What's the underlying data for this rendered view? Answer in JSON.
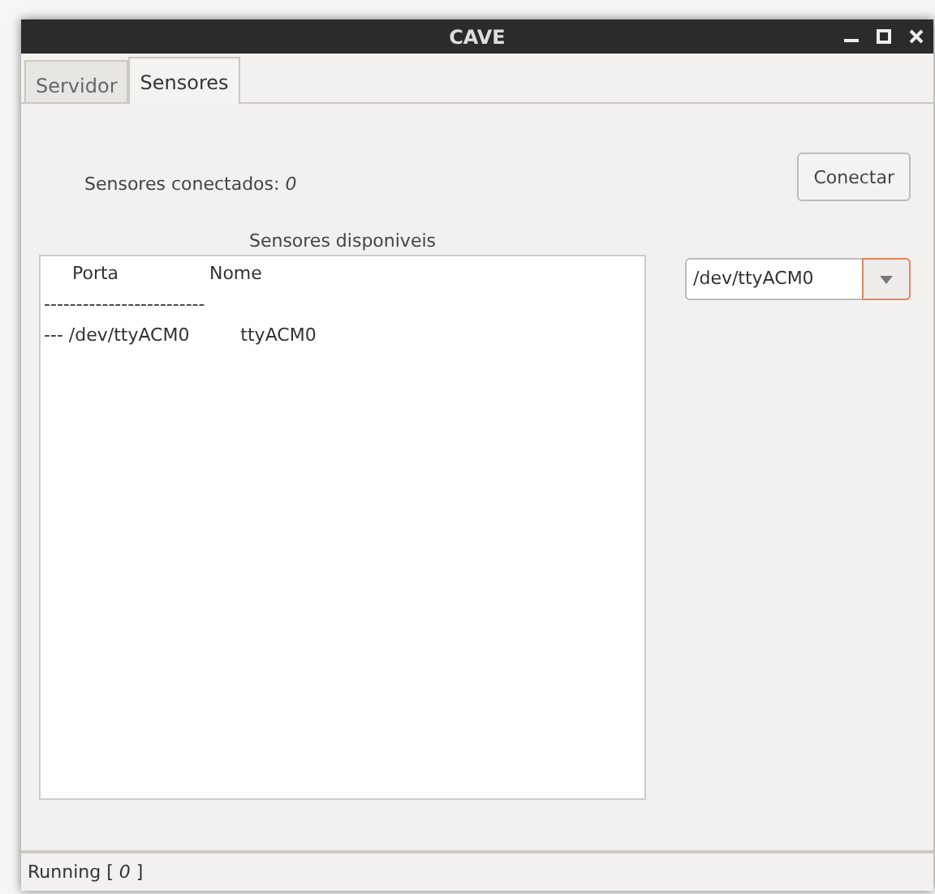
{
  "window": {
    "title": "CAVE"
  },
  "tabs": [
    {
      "label": "Servidor",
      "selected": false
    },
    {
      "label": "Sensores",
      "selected": true
    }
  ],
  "connected_label": "Sensores conectados: ",
  "connected_count": "0",
  "connect_button": "Conectar",
  "list_title": "Sensores disponiveis",
  "list_lines": [
    "     Porta                Nome",
    "-------------------------",
    "--- /dev/ttyACM0         ttyACM0"
  ],
  "port_select": {
    "value": "/dev/ttyACM0"
  },
  "status_bar": {
    "text": "Running [ ",
    "count": "0",
    "end": " ]"
  }
}
